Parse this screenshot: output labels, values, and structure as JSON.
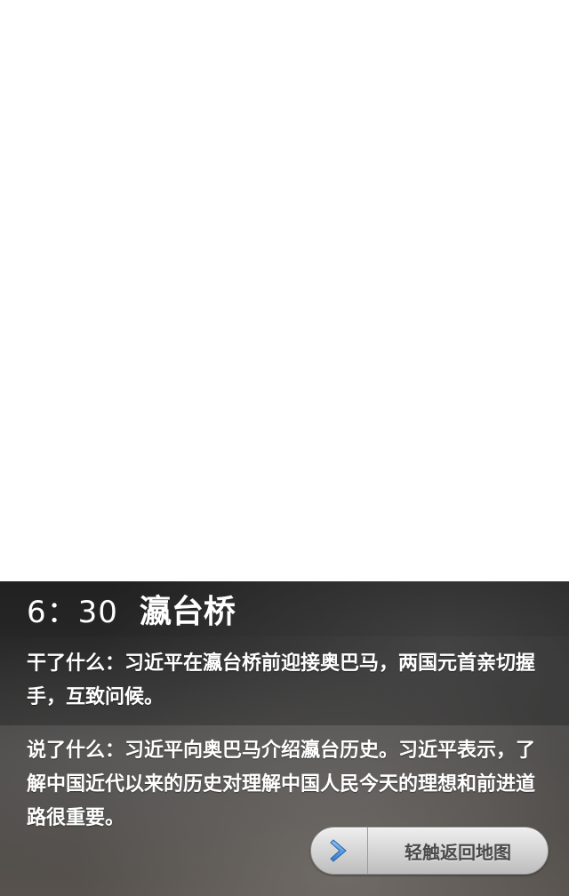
{
  "header": {
    "time": "6：30",
    "place": "瀛台桥"
  },
  "content": {
    "did": "干了什么：习近平在瀛台桥前迎接奥巴马，两国元首亲切握手，互致问候。",
    "said": "说了什么：习近平向奥巴马介绍瀛台历史。习近平表示，了解中国近代以来的历史对理解中国人民今天的理想和前进道路很重要。"
  },
  "actions": {
    "back_label": "轻触返回地图",
    "back_icon": "chevron-right-icon"
  },
  "colors": {
    "panel_bg": "#3a3a3a",
    "text": "#ffffff",
    "button_bg": "#d6d6d6",
    "button_text": "#4a4a4a",
    "icon_blue": "#3d8fe0"
  }
}
